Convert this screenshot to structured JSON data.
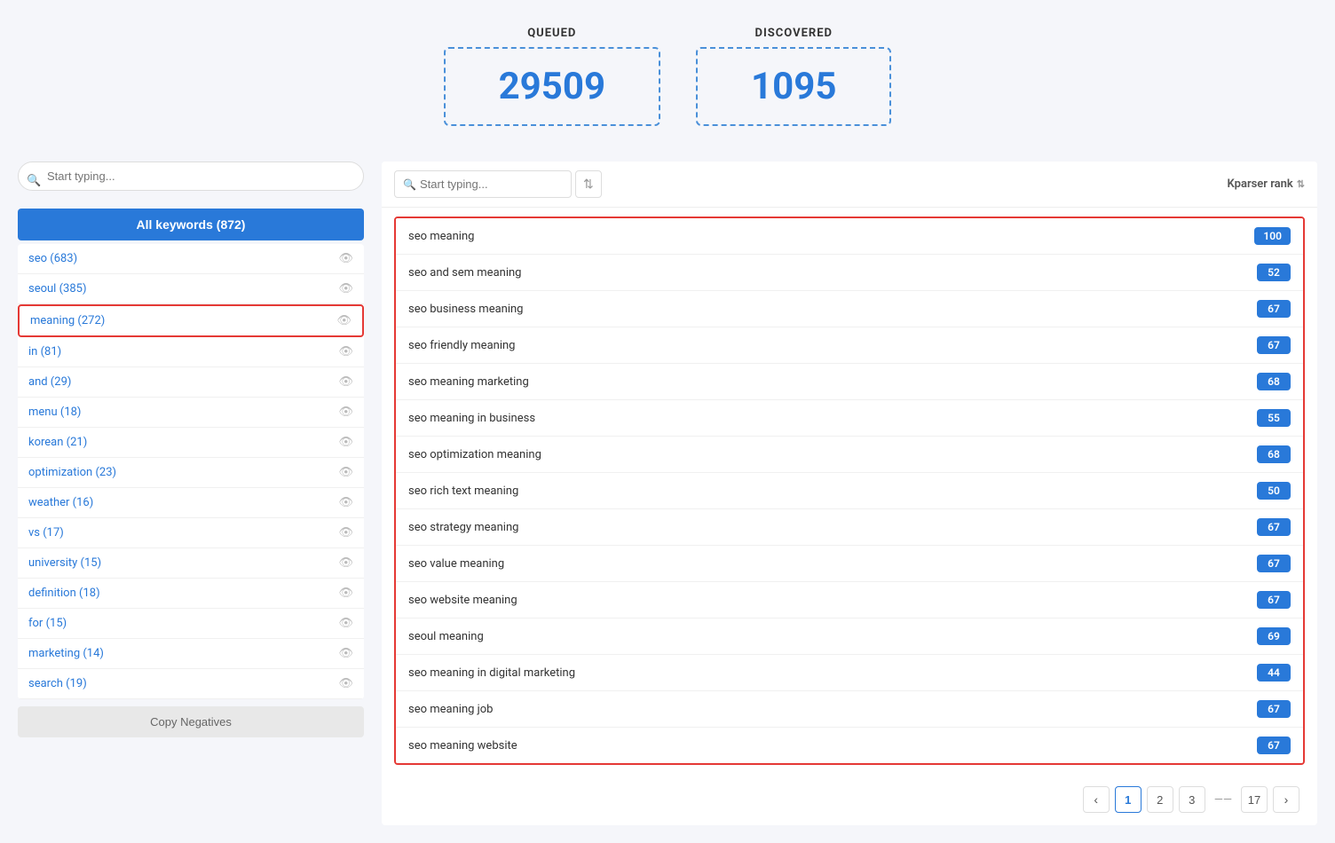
{
  "stats": {
    "queued_label": "QUEUED",
    "queued_value": "29509",
    "discovered_label": "DISCOVERED",
    "discovered_value": "1095"
  },
  "sidebar": {
    "search_placeholder": "Start typing...",
    "all_keywords_label": "All keywords (872)",
    "keywords": [
      {
        "text": "seo (683)",
        "count": 683
      },
      {
        "text": "seoul (385)",
        "count": 385
      },
      {
        "text": "meaning (272)",
        "count": 272,
        "active": true
      },
      {
        "text": "in (81)",
        "count": 81
      },
      {
        "text": "and (29)",
        "count": 29
      },
      {
        "text": "menu (18)",
        "count": 18
      },
      {
        "text": "korean (21)",
        "count": 21
      },
      {
        "text": "optimization (23)",
        "count": 23
      },
      {
        "text": "weather (16)",
        "count": 16
      },
      {
        "text": "vs (17)",
        "count": 17
      },
      {
        "text": "university (15)",
        "count": 15
      },
      {
        "text": "definition (18)",
        "count": 18
      },
      {
        "text": "for (15)",
        "count": 15
      },
      {
        "text": "marketing (14)",
        "count": 14
      },
      {
        "text": "search (19)",
        "count": 19
      }
    ],
    "copy_negatives_label": "Copy Negatives"
  },
  "panel": {
    "search_placeholder": "Start typing...",
    "col_header": "Kparser rank",
    "keywords": [
      {
        "name": "seo meaning",
        "rank": 100
      },
      {
        "name": "seo and sem meaning",
        "rank": 52
      },
      {
        "name": "seo business meaning",
        "rank": 67
      },
      {
        "name": "seo friendly meaning",
        "rank": 67
      },
      {
        "name": "seo meaning marketing",
        "rank": 68
      },
      {
        "name": "seo meaning in business",
        "rank": 55
      },
      {
        "name": "seo optimization meaning",
        "rank": 68
      },
      {
        "name": "seo rich text meaning",
        "rank": 50
      },
      {
        "name": "seo strategy meaning",
        "rank": 67
      },
      {
        "name": "seo value meaning",
        "rank": 67
      },
      {
        "name": "seo website meaning",
        "rank": 67
      },
      {
        "name": "seoul meaning",
        "rank": 69
      },
      {
        "name": "seo meaning in digital marketing",
        "rank": 44
      },
      {
        "name": "seo meaning job",
        "rank": 67
      },
      {
        "name": "seo meaning website",
        "rank": 67
      }
    ],
    "pagination": {
      "prev_label": "‹",
      "next_label": "›",
      "pages": [
        "1",
        "2",
        "3"
      ],
      "last_page": "17",
      "current_page": "1"
    }
  }
}
